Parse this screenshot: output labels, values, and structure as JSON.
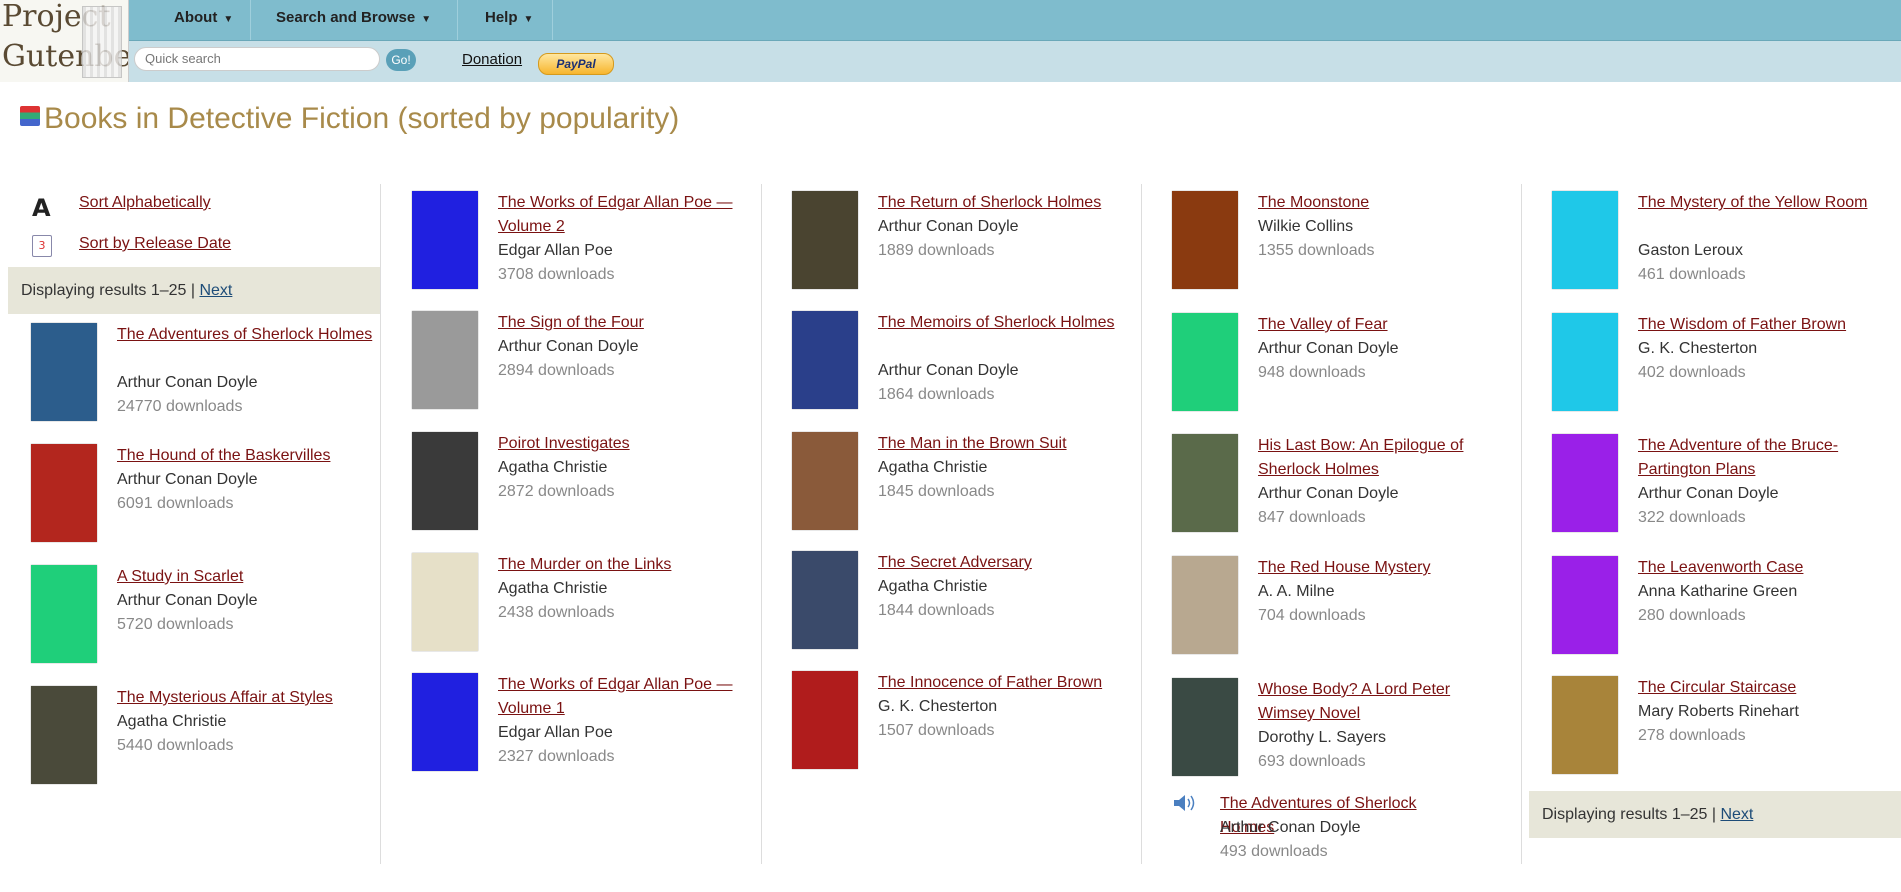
{
  "logo": {
    "line1": "Project",
    "line2": "Gutenberg"
  },
  "nav": {
    "about": "About",
    "search_browse": "Search and Browse",
    "help": "Help"
  },
  "search": {
    "placeholder": "Quick search",
    "go_label": "Go!"
  },
  "donation": "Donation",
  "paypal": "PayPal",
  "page_title": "Books in Detective Fiction (sorted by popularity)",
  "sort": {
    "alpha": "Sort Alphabetically",
    "release": "Sort by Release Date"
  },
  "results": {
    "text": "Displaying results 1–25 | ",
    "next": "Next"
  },
  "books": [
    {
      "title": "The Adventures of Sherlock Holmes",
      "author": "Arthur Conan Doyle",
      "downloads": "24770 downloads",
      "cover_color": "#2c5d8c"
    },
    {
      "title": "The Hound of the Baskervilles",
      "author": "Arthur Conan Doyle",
      "downloads": "6091 downloads",
      "cover_color": "#b3261e"
    },
    {
      "title": "A Study in Scarlet",
      "author": "Arthur Conan Doyle",
      "downloads": "5720 downloads",
      "cover_color": "#1fcf7a"
    },
    {
      "title": "The Mysterious Affair at Styles",
      "author": "Agatha Christie",
      "downloads": "5440 downloads",
      "cover_color": "#4a4a3a"
    },
    {
      "title": "The Works of Edgar Allan Poe — Volume 2",
      "author": "Edgar Allan Poe",
      "downloads": "3708 downloads",
      "cover_color": "#2020e0"
    },
    {
      "title": "The Sign of the Four",
      "author": "Arthur Conan Doyle",
      "downloads": "2894 downloads",
      "cover_color": "#9a9a9a"
    },
    {
      "title": "Poirot Investigates",
      "author": "Agatha Christie",
      "downloads": "2872 downloads",
      "cover_color": "#3a3a3a"
    },
    {
      "title": "The Murder on the Links",
      "author": "Agatha Christie",
      "downloads": "2438 downloads",
      "cover_color": "#e6e0c8"
    },
    {
      "title": "The Works of Edgar Allan Poe — Volume 1",
      "author": "Edgar Allan Poe",
      "downloads": "2327 downloads",
      "cover_color": "#2020e0"
    },
    {
      "title": "The Return of Sherlock Holmes",
      "author": "Arthur Conan Doyle",
      "downloads": "1889 downloads",
      "cover_color": "#4a4430"
    },
    {
      "title": "The Memoirs of Sherlock Holmes",
      "author": "Arthur Conan Doyle",
      "downloads": "1864 downloads",
      "cover_color": "#2a3f8a"
    },
    {
      "title": "The Man in the Brown Suit",
      "author": "Agatha Christie",
      "downloads": "1845 downloads",
      "cover_color": "#8a5a3a"
    },
    {
      "title": "The Secret Adversary",
      "author": "Agatha Christie",
      "downloads": "1844 downloads",
      "cover_color": "#3a4a6a"
    },
    {
      "title": "The Innocence of Father Brown",
      "author": "G. K. Chesterton",
      "downloads": "1507 downloads",
      "cover_color": "#b01c1c"
    },
    {
      "title": "The Moonstone",
      "author": "Wilkie Collins",
      "downloads": "1355 downloads",
      "cover_color": "#8a3a10"
    },
    {
      "title": "The Valley of Fear",
      "author": "Arthur Conan Doyle",
      "downloads": "948 downloads",
      "cover_color": "#1fcf7a"
    },
    {
      "title": "His Last Bow: An Epilogue of Sherlock Holmes",
      "author": "Arthur Conan Doyle",
      "downloads": "847 downloads",
      "cover_color": "#5a6a4a"
    },
    {
      "title": "The Red House Mystery",
      "author": "A. A. Milne",
      "downloads": "704 downloads",
      "cover_color": "#b8a890"
    },
    {
      "title": "Whose Body? A Lord Peter Wimsey Novel",
      "author": "Dorothy L. Sayers",
      "downloads": "693 downloads",
      "cover_color": "#3a4a44"
    },
    {
      "title": "The Adventures of Sherlock Holmes",
      "author": "Arthur Conan Doyle",
      "downloads": "493 downloads",
      "cover_color": ""
    },
    {
      "title": "The Mystery of the Yellow Room",
      "author": "Gaston Leroux",
      "downloads": "461 downloads",
      "cover_color": "#1fc8e8"
    },
    {
      "title": "The Wisdom of Father Brown",
      "author": "G. K. Chesterton",
      "downloads": "402 downloads",
      "cover_color": "#1fc8e8"
    },
    {
      "title": "The Adventure of the Bruce-Partington Plans",
      "author": "Arthur Conan Doyle",
      "downloads": "322 downloads",
      "cover_color": "#9a20e8"
    },
    {
      "title": "The Leavenworth Case",
      "author": "Anna Katharine Green",
      "downloads": "280 downloads",
      "cover_color": "#9a20e8"
    },
    {
      "title": "The Circular Staircase",
      "author": "Mary Roberts Rinehart",
      "downloads": "278 downloads",
      "cover_color": "#a8843a"
    }
  ]
}
